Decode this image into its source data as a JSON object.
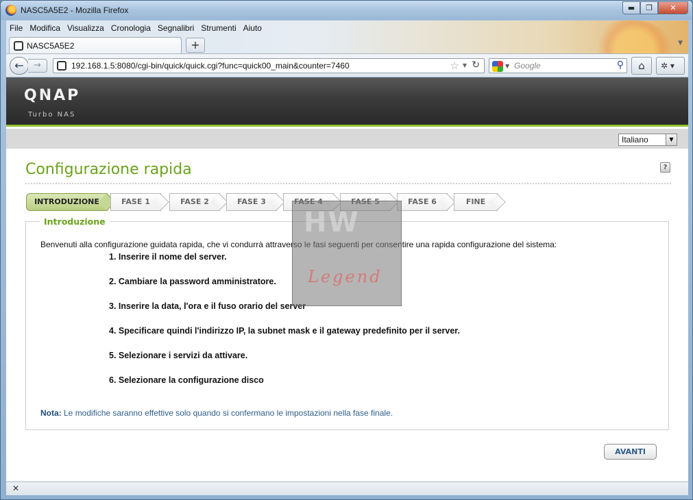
{
  "window": {
    "title": "NASC5A5E2 - Mozilla Firefox",
    "minimize": "▬",
    "maximize": "❐",
    "close": "✕"
  },
  "menubar": {
    "items": [
      "File",
      "Modifica",
      "Visualizza",
      "Cronologia",
      "Segnalibri",
      "Strumenti",
      "Aiuto"
    ]
  },
  "tabs": {
    "active_label": "NASC5A5E2",
    "new_tab": "+"
  },
  "navbar": {
    "url": "192.168.1.5:8080/cgi-bin/quick/quick.cgi?func=quick00_main&counter=7460",
    "search_engine": "Google",
    "back_icon": "back-arrow-icon",
    "forward_icon": "forward-arrow-icon"
  },
  "header": {
    "logo": "QNAP",
    "subtitle": "Turbo NAS"
  },
  "language": {
    "selected": "Italiano"
  },
  "main": {
    "title": "Configurazione rapida",
    "help": "?",
    "steps": [
      "INTRODUZIONE",
      "FASE 1",
      "FASE 2",
      "FASE 3",
      "FASE 4",
      "FASE 5",
      "FASE 6",
      "FINE"
    ],
    "active_step": 0,
    "section_title": "Introduzione",
    "intro_text": "Benvenuti alla configurazione guidata rapida, che vi condurrà attraverso le fasi seguenti per consentire una rapida configurazione del sistema:",
    "list": [
      "1. Inserire il nome del server.",
      "2. Cambiare la password amministratore.",
      "3. Inserire la data, l'ora e il fuso orario del server",
      "4. Specificare quindi l'indirizzo IP, la subnet mask e il gateway predefinito per il server.",
      "5. Selezionare i servizi da attivare.",
      "6. Selezionare la configurazione disco"
    ],
    "note_label": "Nota:",
    "note_text": " Le modifiche saranno effettive solo quando si confermano le impostazioni nella fase finale.",
    "next_button": "AVANTI"
  },
  "watermark": {
    "top": "HW",
    "bottom": "Legend"
  },
  "colors": {
    "accent_green": "#6aa21b",
    "header_dark": "#3e3d3d",
    "note_blue": "#2f5d8a"
  }
}
